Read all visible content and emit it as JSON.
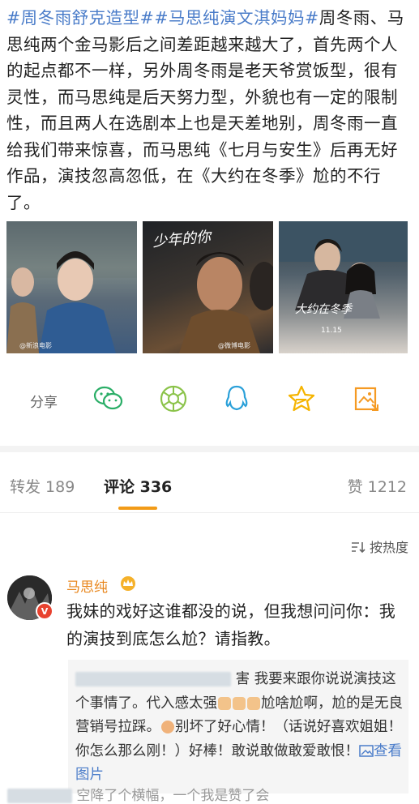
{
  "post": {
    "tag1": "#周冬雨舒克造型#",
    "tag2": "#马思纯演文淇妈妈#",
    "body": "周冬雨、马思纯两个金马影后之间差距越来越大了，首先两个人的起点都不一样，另外周冬雨是老天爷赏饭型，很有灵性，而马思纯是后天努力型，外貌也有一定的限制性，而且两人在选剧本上也是天差地别，周冬雨一直给我们带来惊喜，而马思纯《七月与安生》后再无好作品，演技忽高忽低，在《大约在冬季》尬的不行了。"
  },
  "images": {
    "img1_watermark": "@新浪电影",
    "img2_title": "少年的你",
    "img2_watermark": "@微博电影",
    "img3_title": "大约在冬季",
    "img3_date": "11.15"
  },
  "actions": {
    "share_label": "分享",
    "icons": [
      "wechat-icon",
      "moments-icon",
      "qq-icon",
      "qzone-star-icon",
      "save-image-icon"
    ]
  },
  "tabs": {
    "repost": "转发 189",
    "comments": "评论 336",
    "likes": "赞 1212"
  },
  "sort": {
    "label": "按热度"
  },
  "comment": {
    "username": "马思纯",
    "text": "我妹的戏好这谁都没的说，但我想问问你：我的演技到底怎么尬？请指教。",
    "verified": "V"
  },
  "reply": {
    "part1": "害 我要来跟你说说演技这个事情了。代入感太强",
    "part2": "尬啥尬啊，尬的是无良营销号拉踩。",
    "part3": "别坏了好心情！（话说好喜欢姐姐！你怎么那么刚！）好棒！敢说敢做敢爱敢恨！",
    "view_image": "查看图片",
    "next_line": "空降了个横幅，一个我是赞了会"
  },
  "colors": {
    "link": "#4a7cc9",
    "accent": "#f29b17",
    "username": "#e8861c"
  }
}
